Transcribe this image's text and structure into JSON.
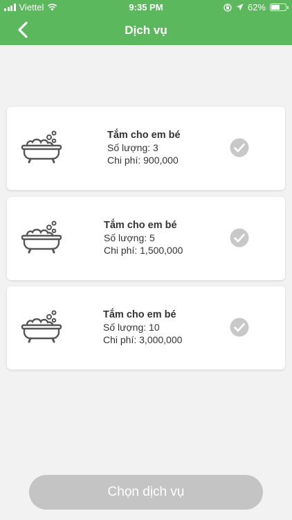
{
  "status_bar": {
    "carrier": "Viettel",
    "time": "9:35 PM",
    "battery_label": "62%",
    "battery_level": 0.62
  },
  "header": {
    "title": "Dịch vụ",
    "back_icon": "chevron-left-icon"
  },
  "services": [
    {
      "name": "Tắm cho em bé",
      "quantity": "Số lượng: 3",
      "cost": "Chi phí: 900,000",
      "icon": "bathtub-icon",
      "selected_icon": "check-circle-icon"
    },
    {
      "name": "Tắm cho em bé",
      "quantity": "Số lượng: 5",
      "cost": "Chi phí: 1,500,000",
      "icon": "bathtub-icon",
      "selected_icon": "check-circle-icon"
    },
    {
      "name": "Tắm cho em bé",
      "quantity": "Số lượng: 10",
      "cost": "Chi phí: 3,000,000",
      "icon": "bathtub-icon",
      "selected_icon": "check-circle-icon"
    }
  ],
  "footer": {
    "choose_label": "Chọn dịch vụ"
  },
  "colors": {
    "header": "#5cb85c",
    "check": "#c8c8c8",
    "button_disabled": "#c4c4c4"
  }
}
